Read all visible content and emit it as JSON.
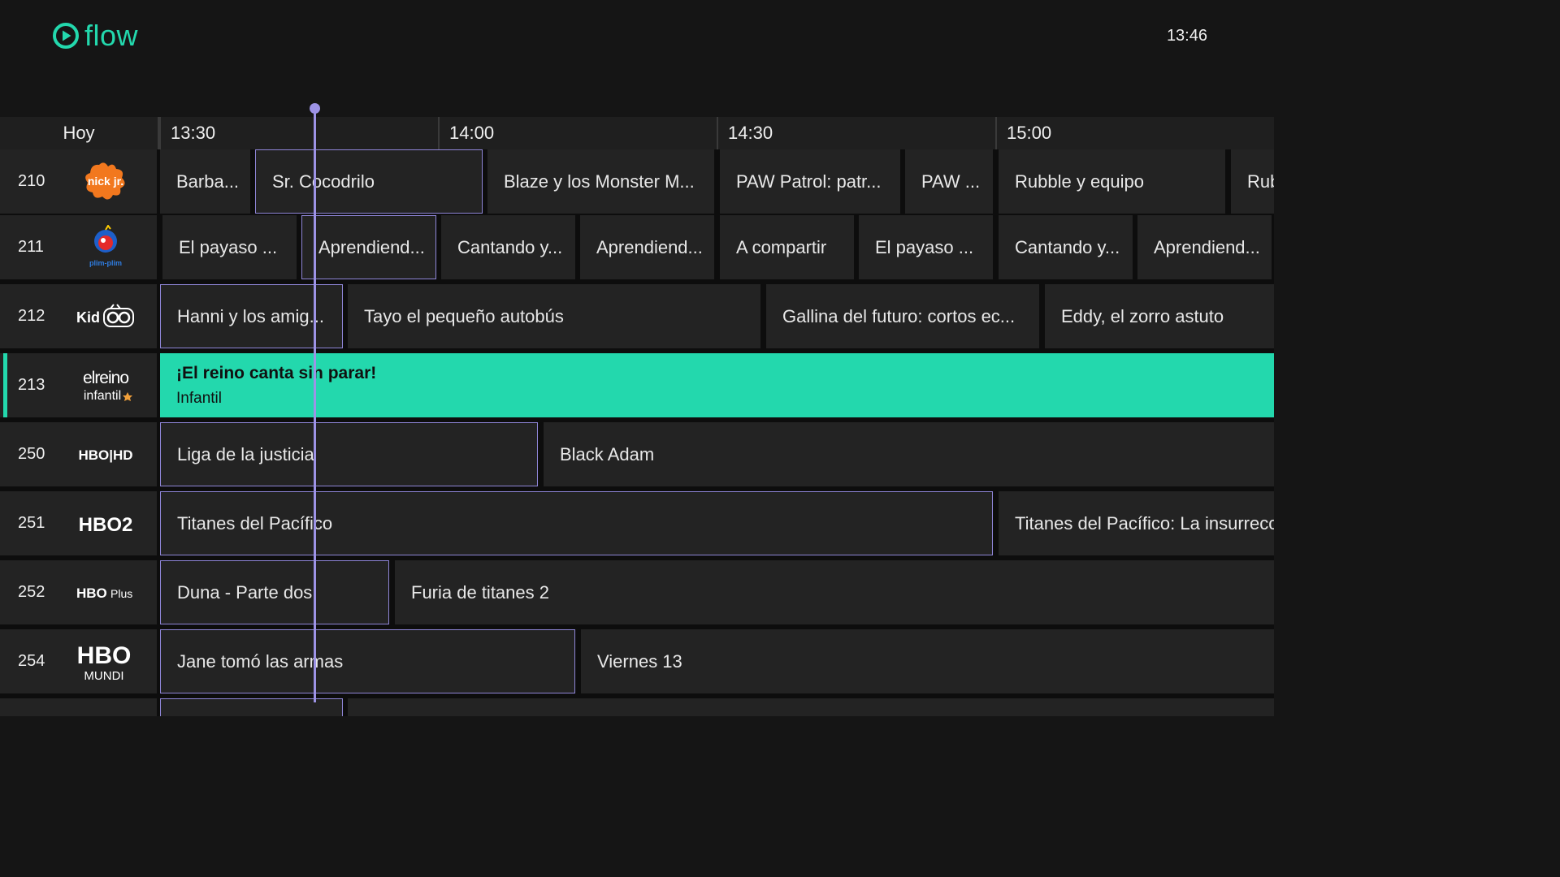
{
  "app": {
    "name": "flow",
    "clock": "13:46"
  },
  "colors": {
    "accent": "#23d8ad",
    "now_line": "#9d93e6",
    "outline": "#8f86d8"
  },
  "timeline": {
    "today_label": "Hoy",
    "ticks": [
      "13:30",
      "14:00",
      "14:30",
      "15:00"
    ]
  },
  "channels": [
    {
      "number": "210",
      "logo": "nick-jr-logo",
      "logo_text": "nick jr.",
      "programs": [
        "Barba...",
        "Sr. Cocodrilo",
        "Blaze y los Monster M...",
        "PAW Patrol: patr...",
        "PAW ...",
        "Rubble y equipo",
        "Rub"
      ]
    },
    {
      "number": "211",
      "logo": "plim-plim-logo",
      "logo_text": "plim-plim",
      "programs": [
        "El payaso ...",
        "Aprendiend...",
        "Cantando y...",
        "Aprendiend...",
        "A compartir",
        "El payaso ...",
        "Cantando y...",
        "Aprendiend..."
      ]
    },
    {
      "number": "212",
      "logo": "kidoo-logo",
      "logo_text": "Kidoo",
      "programs": [
        "Hanni y los amig...",
        "Tayo el pequeño autobús",
        "Gallina del futuro: cortos ec...",
        "Eddy, el zorro astuto"
      ]
    },
    {
      "number": "213",
      "logo": "el-reino-infantil-logo",
      "logo_text_1": "elreino",
      "logo_text_2": "infantil",
      "programs": [
        {
          "title": "¡El reino canta sin parar!",
          "genre": "Infantil"
        }
      ]
    },
    {
      "number": "250",
      "logo": "hbo-hd-logo",
      "logo_text": "HBO|HD",
      "programs": [
        "Liga de la justicia",
        "Black Adam"
      ]
    },
    {
      "number": "251",
      "logo": "hbo2-logo",
      "logo_text": "HBO2",
      "programs": [
        "Titanes del Pacífico",
        "Titanes del Pacífico: La insurrecc"
      ]
    },
    {
      "number": "252",
      "logo": "hbo-plus-logo",
      "logo_text_1": "HBO",
      "logo_text_2": "Plus",
      "programs": [
        "Duna - Parte dos",
        "Furia de titanes 2"
      ]
    },
    {
      "number": "254",
      "logo": "hbo-mundi-logo",
      "logo_text_1": "HBO",
      "logo_text_2": "MUNDI",
      "programs": [
        "Jane tomó las armas",
        "Viernes 13"
      ]
    }
  ]
}
